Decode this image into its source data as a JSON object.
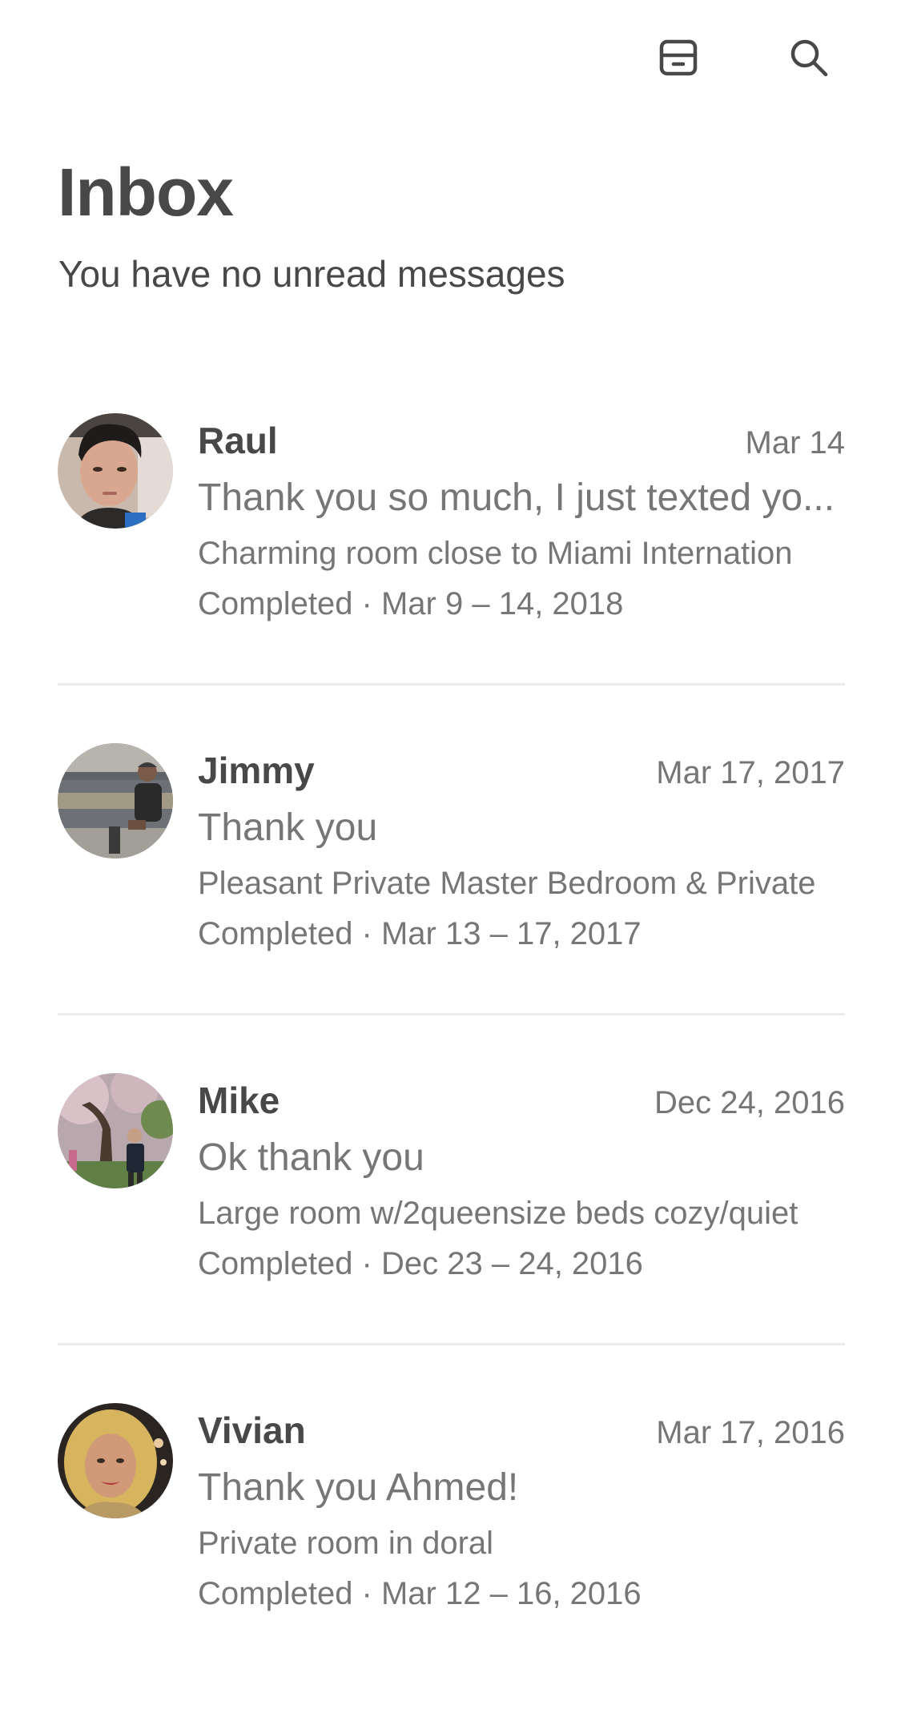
{
  "header": {
    "archive_icon": "archive-tray-icon",
    "search_icon": "search-icon"
  },
  "inbox": {
    "title": "Inbox",
    "subtitle": "You have no unread messages"
  },
  "threads": [
    {
      "name": "Raul",
      "date": "Mar 14",
      "message": "Thank you so much, I just texted yo...",
      "listing": "Charming room close to Miami Internation",
      "status": "Completed · Mar 9 – 14, 2018"
    },
    {
      "name": "Jimmy",
      "date": "Mar 17, 2017",
      "message": "Thank you",
      "listing": "Pleasant Private Master Bedroom & Private",
      "status": "Completed · Mar 13 – 17, 2017"
    },
    {
      "name": "Mike",
      "date": "Dec 24, 2016",
      "message": "Ok thank you",
      "listing": "Large room w/2queensize beds cozy/quiet",
      "status": "Completed · Dec 23 – 24, 2016"
    },
    {
      "name": "Vivian",
      "date": "Mar 17, 2016",
      "message": "Thank you Ahmed!",
      "listing": "Private room in doral",
      "status": "Completed · Mar 12 – 16, 2016"
    }
  ],
  "colors": {
    "text_primary": "#484848",
    "text_secondary": "#767676",
    "divider": "#ebebeb"
  }
}
